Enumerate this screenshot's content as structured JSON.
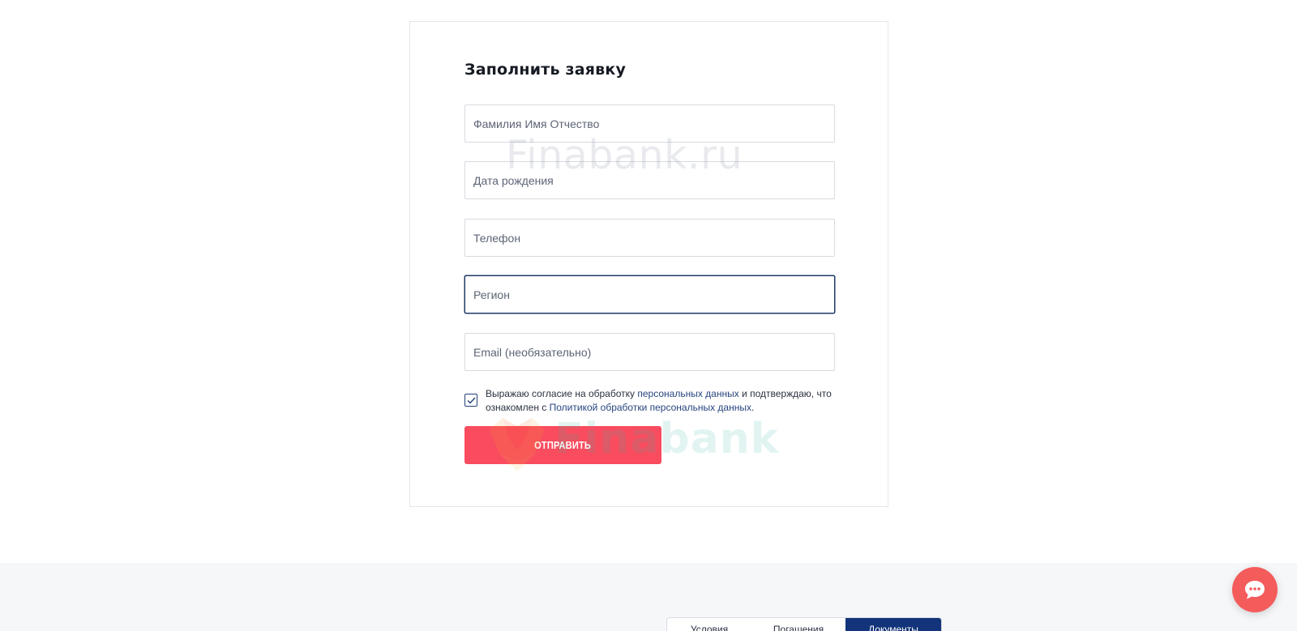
{
  "form": {
    "title": "Заполнить заявку",
    "fields": [
      {
        "placeholder": "Фамилия Имя Отчество"
      },
      {
        "placeholder": "Дата рождения"
      },
      {
        "placeholder": "Телефон"
      },
      {
        "placeholder": "Регион"
      },
      {
        "placeholder": "Email (необязательно)"
      }
    ],
    "consent": {
      "checked": true,
      "text_1": "Выражаю согласие на обработку ",
      "link_1": "персональных данных",
      "text_2": " и подтверждаю, что ознакомлен с ",
      "link_2": "Политикой обработки персональных данных",
      "text_3": "."
    },
    "submit_label": "ОТПРАВИТЬ"
  },
  "watermark": {
    "text": "Finabank.ru",
    "logo_word": "Finabank"
  },
  "footer": {
    "tabs": [
      {
        "label": "Условия"
      },
      {
        "label": "Погашения"
      },
      {
        "label": "Документы",
        "active": true
      }
    ]
  },
  "colors": {
    "accent_button": "#f94c5f",
    "tab_active": "#13347a",
    "link": "#27457f",
    "chat_button": "#f45b5b"
  },
  "icons": {
    "checkbox": "check-icon",
    "chat": "chat-bubble-icon"
  }
}
